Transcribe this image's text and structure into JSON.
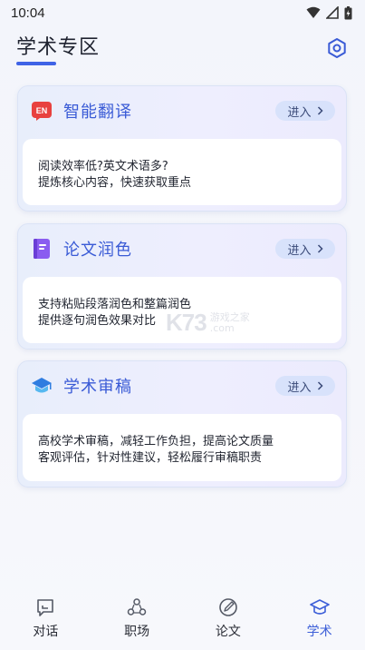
{
  "status_bar": {
    "time": "10:04"
  },
  "header": {
    "title": "学术专区"
  },
  "cards": [
    {
      "title": "智能翻译",
      "icon_text": "EN",
      "enter_label": "进入",
      "lines": [
        "阅读效率低?英文术语多?",
        "提炼核心内容，快速获取重点"
      ]
    },
    {
      "title": "论文润色",
      "enter_label": "进入",
      "lines": [
        "支持粘贴段落润色和整篇润色",
        "提供逐句润色效果对比"
      ]
    },
    {
      "title": "学术审稿",
      "enter_label": "进入",
      "lines": [
        "高校学术审稿，减轻工作负担，提高论文质量",
        "客观评估，针对性建议，轻松履行审稿职责"
      ]
    }
  ],
  "watermark": {
    "logo": "K73",
    "line1": "游戏之家",
    "line2": ".com"
  },
  "tabs": [
    {
      "label": "对话",
      "icon": "chat-icon",
      "active": false
    },
    {
      "label": "职场",
      "icon": "workplace-icon",
      "active": false
    },
    {
      "label": "论文",
      "icon": "paper-icon",
      "active": false
    },
    {
      "label": "学术",
      "icon": "graduation-cap-icon",
      "active": true
    }
  ],
  "colors": {
    "accent": "#3d5fd8",
    "card_title": "#3a5bd6",
    "enter_bg": "#d8e2fb"
  }
}
